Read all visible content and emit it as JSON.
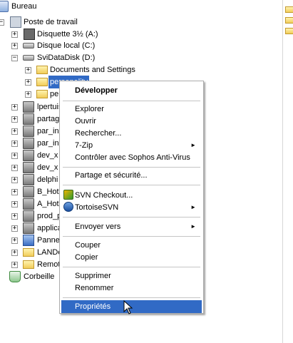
{
  "tree": {
    "items": [
      {
        "label": "Bureau",
        "icon": "desktop-icon"
      },
      {
        "label": "Poste de travail",
        "icon": "computer-icon"
      },
      {
        "label": "Disquette 3½ (A:)",
        "icon": "floppy-drive-icon"
      },
      {
        "label": "Disque local (C:)",
        "icon": "hard-drive-icon"
      },
      {
        "label": "SviDataDisk (D:)",
        "icon": "hard-drive-icon"
      },
      {
        "label": "Documents and Settings",
        "icon": "folder-icon"
      },
      {
        "label": "personality",
        "icon": "folder-icon"
      },
      {
        "label": "pe",
        "icon": "folder-icon"
      },
      {
        "label": "lpertuis",
        "icon": "network-drive-icon"
      },
      {
        "label": "partag",
        "icon": "network-drive-icon"
      },
      {
        "label": "par_in",
        "icon": "network-drive-icon"
      },
      {
        "label": "par_in",
        "icon": "network-drive-icon"
      },
      {
        "label": "dev_x",
        "icon": "network-drive-icon"
      },
      {
        "label": "dev_x",
        "icon": "network-drive-icon"
      },
      {
        "label": "delphi",
        "icon": "network-drive-icon"
      },
      {
        "label": "B_Hote",
        "icon": "network-drive-icon"
      },
      {
        "label": "A_Hote",
        "icon": "network-drive-icon"
      },
      {
        "label": "prod_p",
        "icon": "network-drive-icon"
      },
      {
        "label": "applica",
        "icon": "network-drive-icon"
      },
      {
        "label": "Pannea",
        "icon": "control-panel-icon"
      },
      {
        "label": "LANDe",
        "icon": "network-folder-icon"
      },
      {
        "label": "Remot",
        "icon": "network-folder-icon"
      },
      {
        "label": "Corbeille",
        "icon": "recycle-bin-icon"
      }
    ]
  },
  "context_menu": {
    "items": [
      {
        "label": "Développer"
      },
      {
        "label": "Explorer"
      },
      {
        "label": "Ouvrir"
      },
      {
        "label": "Rechercher..."
      },
      {
        "label": "7-Zip"
      },
      {
        "label": "Contrôler avec Sophos Anti-Virus"
      },
      {
        "label": "Partage et sécurité..."
      },
      {
        "label": "SVN Checkout..."
      },
      {
        "label": "TortoiseSVN"
      },
      {
        "label": "Envoyer vers"
      },
      {
        "label": "Couper"
      },
      {
        "label": "Copier"
      },
      {
        "label": "Supprimer"
      },
      {
        "label": "Renommer"
      },
      {
        "label": "Propriétés"
      }
    ],
    "submenu_arrow": "►",
    "highlight_color": "#316ac5"
  },
  "expander": {
    "plus": "+",
    "minus": "−"
  }
}
